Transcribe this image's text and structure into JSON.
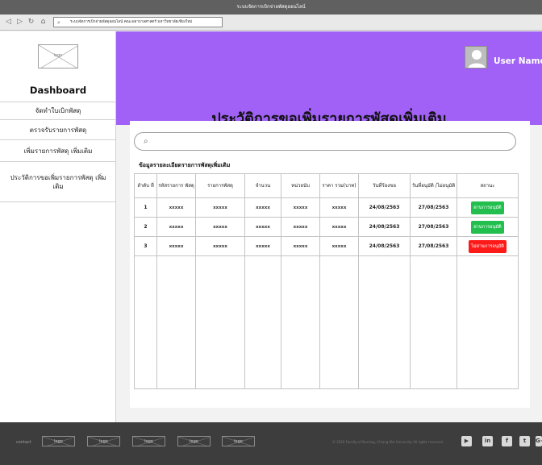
{
  "window": {
    "title": "ระบบจัดการเบิกจ่ายพัสดุออนไลน์"
  },
  "browser": {
    "url": "ระบบจัดการเบิกจ่ายพัสดุออนไลน์ คณะพยาบาลศาสตร์ มหาวิทยาลัยเชียงใหม่",
    "icons": [
      "back-icon",
      "forward-icon",
      "refresh-icon",
      "home-icon",
      "search-icon"
    ]
  },
  "sidebar": {
    "logo": "logo",
    "title": "Dashboard",
    "items": [
      {
        "label": "จัดทำใบเบิกพัสดุ"
      },
      {
        "label": "ตรวจรับรายการพัสดุ"
      },
      {
        "label": "เพิ่มรายการพัสดุ เพิ่มเติม"
      },
      {
        "label": "ประวัติการขอเพิ่มรายการพัสดุ เพิ่มเติม"
      }
    ]
  },
  "header": {
    "user_name": "User Name",
    "page_title": "ประวัติการขอเพิ่มรายการพัสดุเพิ่มเติม"
  },
  "colors": {
    "header": "#a161f6",
    "approved": "#22bf4e",
    "rejected": "#ff1a1a",
    "footer": "#3d3d3d"
  },
  "section": {
    "title": "ข้อมูลรายละเอียดรายการพัสดุเพิ่มเติม",
    "columns": [
      "ลำดับ ที่",
      "รหัสรายการ พัสดุ",
      "รายการพัสดุ",
      "จำนวน",
      "หน่วยนับ",
      "ราคา รวม(บาท)",
      "วันที่ร้องขอ",
      "วันที่อนุมัติ /ไม่อนุมัติ",
      "สถานะ"
    ],
    "rows": [
      {
        "no": "1",
        "code": "xxxxx",
        "item": "xxxxx",
        "qty": "xxxxx",
        "unit": "xxxxx",
        "price": "xxxxx",
        "requested": "24/08/2563",
        "decided": "27/08/2563",
        "status": "ผ่านการอนุมัติ",
        "status_color": "#22bf4e"
      },
      {
        "no": "2",
        "code": "xxxxx",
        "item": "xxxxx",
        "qty": "xxxxx",
        "unit": "xxxxx",
        "price": "xxxxx",
        "requested": "24/08/2563",
        "decided": "27/08/2563",
        "status": "ผ่านการอนุมัติ",
        "status_color": "#22bf4e"
      },
      {
        "no": "3",
        "code": "xxxxx",
        "item": "xxxxx",
        "qty": "xxxxx",
        "unit": "xxxxx",
        "price": "xxxxx",
        "requested": "24/08/2563",
        "decided": "27/08/2563",
        "status": "ไม่ผ่านการอนุมัติ",
        "status_color": "#ff1a1a"
      }
    ]
  },
  "footer": {
    "contact": "contact",
    "logos": [
      "logo",
      "logo",
      "logo",
      "logo",
      "logo"
    ],
    "copyright": "© 2020 Faculty of Nursing, Chiang Mai University All rights reserved.",
    "social": [
      {
        "icon": "youtube-icon",
        "glyph": "▶"
      },
      {
        "icon": "linkedin-icon",
        "glyph": "in"
      },
      {
        "icon": "facebook-icon",
        "glyph": "f"
      },
      {
        "icon": "twitter-icon",
        "glyph": "t"
      },
      {
        "icon": "google-plus-icon",
        "glyph": "G+"
      }
    ]
  }
}
